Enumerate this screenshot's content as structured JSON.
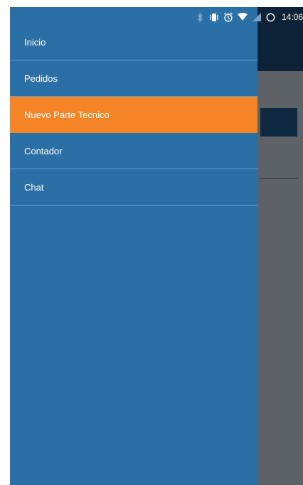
{
  "status_bar": {
    "time": "14:06",
    "icons": [
      "bluetooth-icon",
      "vibrate-icon",
      "alarm-icon",
      "wifi-icon",
      "signal-icon",
      "battery-icon"
    ]
  },
  "drawer": {
    "background_color": "#2a6fa5",
    "active_color": "#f58426",
    "items": [
      {
        "label": "Inicio",
        "active": false
      },
      {
        "label": "Pedidos",
        "active": false
      },
      {
        "label": "Nuevo Parte Tecnico",
        "active": true
      },
      {
        "label": "Contador",
        "active": false
      },
      {
        "label": "Chat",
        "active": false
      }
    ]
  }
}
